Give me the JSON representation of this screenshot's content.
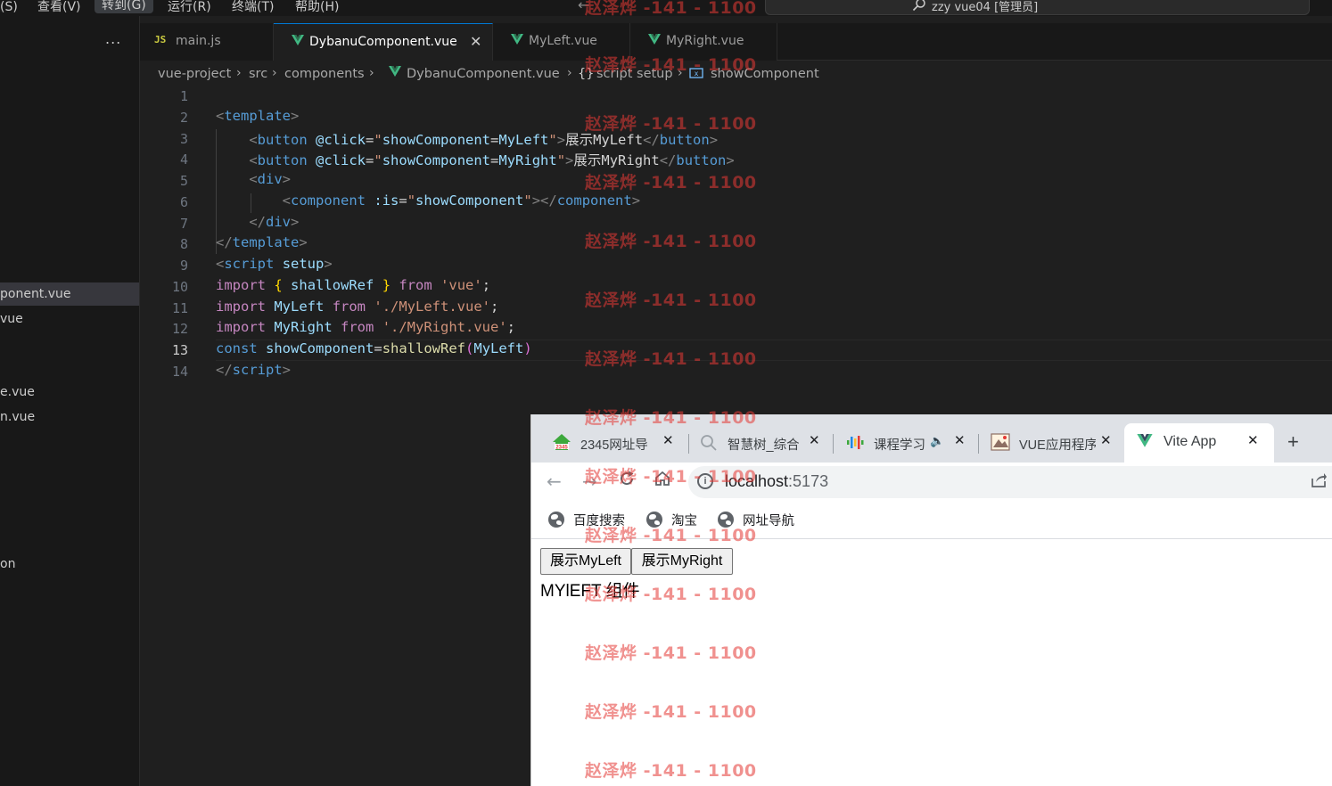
{
  "menu": {
    "items": [
      "选择(S)",
      "查看(V)",
      "转到(G)",
      "运行(R)",
      "终端(T)",
      "帮助(H)"
    ],
    "visible_first": "择(S)",
    "command_center": "zzy vue04 [管理员]"
  },
  "sidebar": {
    "more": "...",
    "items": [
      {
        "label": "ponent.vue",
        "selected": true
      },
      {
        "label": "vue"
      },
      {
        "label": "e.vue"
      },
      {
        "label": "n.vue"
      },
      {
        "label": "on"
      }
    ]
  },
  "tabs": [
    {
      "label": "main.js",
      "icon": "JS"
    },
    {
      "label": "DybanuComponent.vue",
      "active": true
    },
    {
      "label": "MyLeft.vue"
    },
    {
      "label": "MyRight.vue"
    }
  ],
  "breadcrumb": [
    "vue-project",
    "src",
    "components",
    "DybanuComponent.vue",
    "script setup",
    "showComponent"
  ],
  "breadcrumb_icons": {
    "braces": "{}"
  },
  "editor": {
    "current_line": 13,
    "line_numbers": [
      "1",
      "2",
      "3",
      "4",
      "5",
      "6",
      "7",
      "8",
      "9",
      "10",
      "11",
      "12",
      "13",
      "14"
    ]
  },
  "browser": {
    "tabs": [
      {
        "label": "2345网址导"
      },
      {
        "label": "智慧树_综合"
      },
      {
        "label": "课程学习"
      },
      {
        "label": "VUE应用程序"
      },
      {
        "label": "Vite App",
        "active": true
      }
    ],
    "url_host": "localhost",
    "url_port": ":5173",
    "bookmarks": [
      "百度搜索",
      "淘宝",
      "网址导航"
    ],
    "page": {
      "buttons": [
        "展示MyLeft",
        "展示MyRight"
      ],
      "text": "MYlEFT 组件"
    }
  },
  "watermark": "赵泽烨 -141 - 1100"
}
